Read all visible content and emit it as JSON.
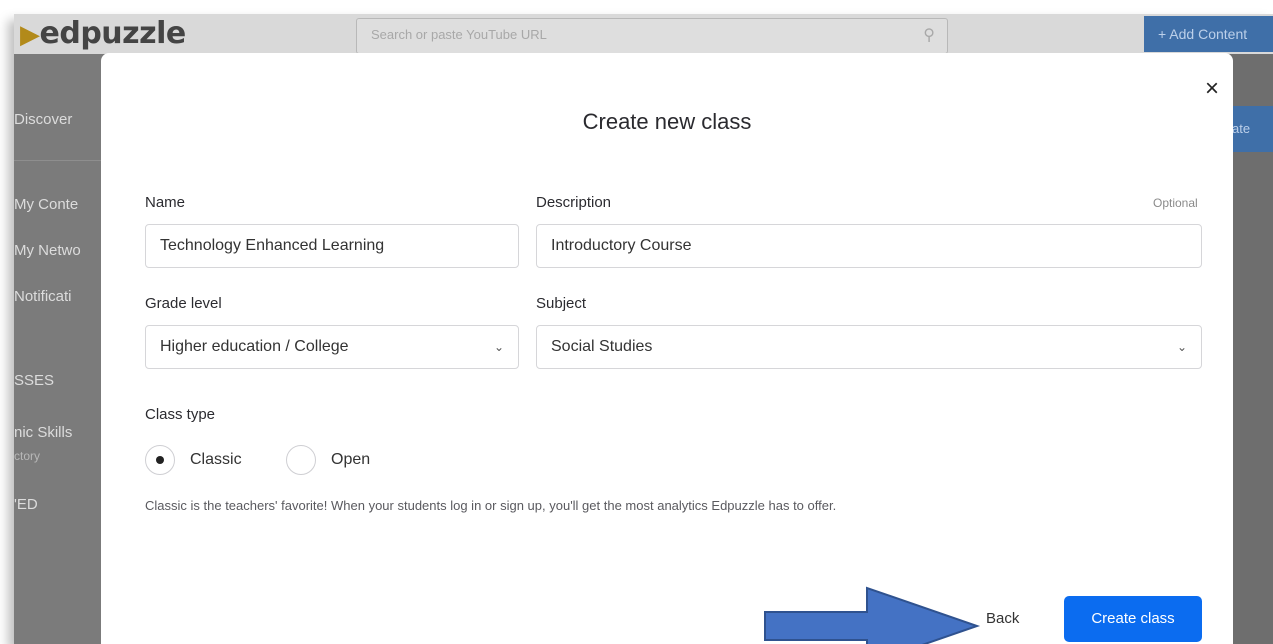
{
  "app": {
    "logo_text": "edpuzzle",
    "search_placeholder": "Search or paste YouTube URL",
    "add_content_label": "+ Add Content",
    "right_button_label": "ate"
  },
  "sidebar": {
    "items": [
      "Discover",
      "My Conte",
      "My Netwo",
      "Notificati",
      "SSES",
      "nic Skills",
      "'ED"
    ],
    "sub_items": [
      "ctory"
    ]
  },
  "modal": {
    "title": "Create new class",
    "close_glyph": "×",
    "name": {
      "label": "Name",
      "value": "Technology Enhanced Learning"
    },
    "description": {
      "label": "Description",
      "optional_label": "Optional",
      "value": "Introductory Course"
    },
    "grade_level": {
      "label": "Grade level",
      "selected": "Higher education / College"
    },
    "subject": {
      "label": "Subject",
      "selected": "Social Studies"
    },
    "class_type": {
      "label": "Class type",
      "options": [
        "Classic",
        "Open"
      ],
      "selected": "Classic",
      "help_text": "Classic is the teachers' favorite! When your students log in or sign up, you'll get the most analytics Edpuzzle has to offer."
    },
    "back_label": "Back",
    "create_label": "Create class"
  },
  "colors": {
    "primary": "#0b6cf0",
    "annotation_arrow": "#4472c4"
  }
}
